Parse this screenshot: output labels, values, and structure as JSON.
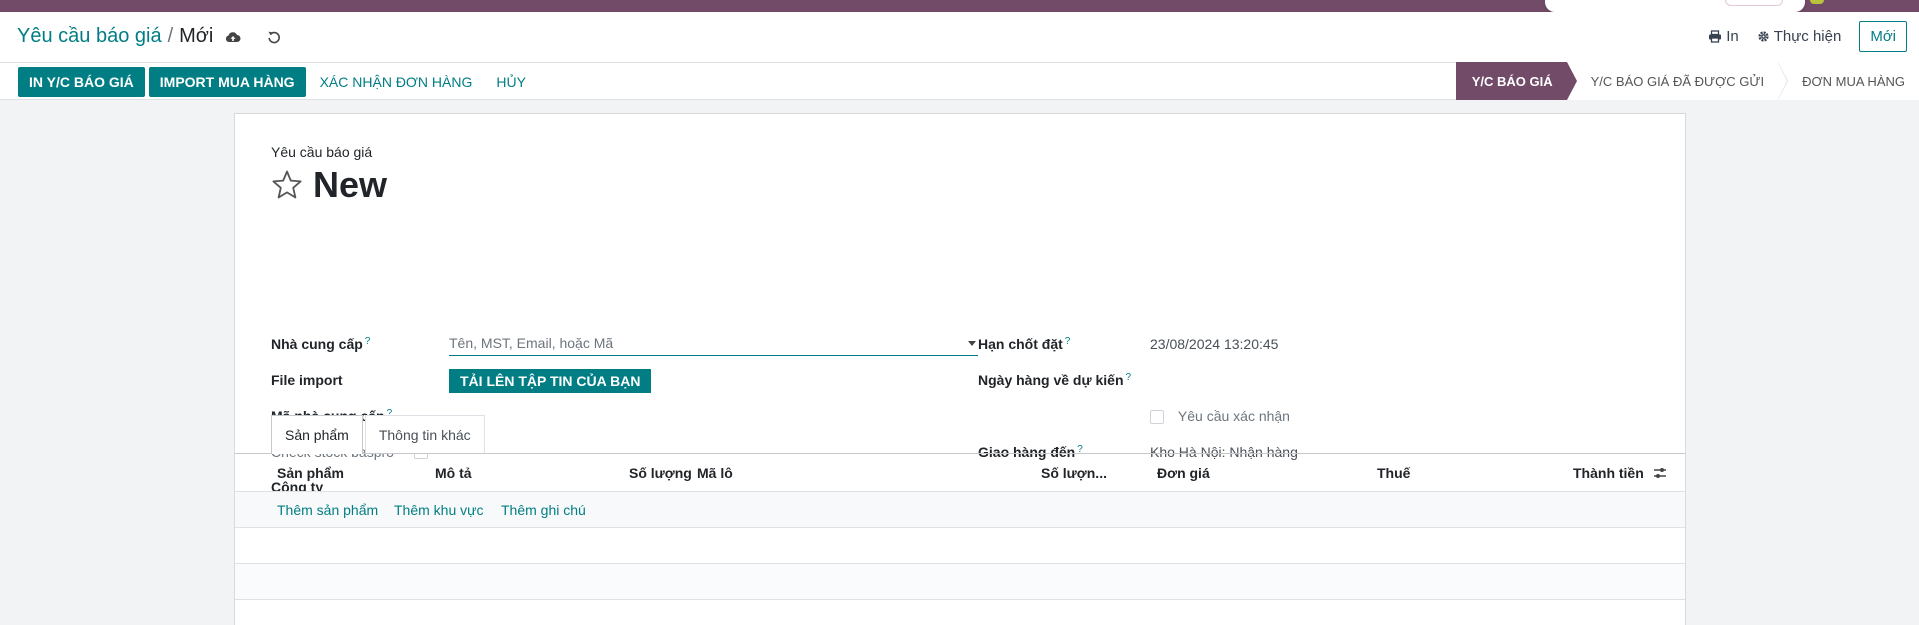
{
  "breadcrumb": {
    "parent": "Yêu cầu báo giá",
    "current": "Mới"
  },
  "control_panel": {
    "save_icon": "cloud-upload-icon",
    "discard_icon": "undo-icon",
    "print_label": "In",
    "action_label": "Thực hiện",
    "new_label": "Mới"
  },
  "statusbar": {
    "buttons": [
      {
        "label": "IN Y/C BÁO GIÁ",
        "style": "primary"
      },
      {
        "label": "IMPORT MUA HÀNG",
        "style": "primary"
      },
      {
        "label": "XÁC NHẬN ĐƠN HÀNG",
        "style": "link"
      },
      {
        "label": "HỦY",
        "style": "link"
      }
    ],
    "stages": [
      {
        "label": "Y/C BÁO GIÁ",
        "active": true
      },
      {
        "label": "Y/C BÁO GIÁ ĐÃ ĐƯỢC GỬI",
        "active": false
      },
      {
        "label": "ĐƠN MUA HÀNG",
        "active": false
      }
    ]
  },
  "form": {
    "subtitle": "Yêu cầu báo giá",
    "name": "New",
    "vendor": {
      "label": "Nhà cung cấp",
      "placeholder": "Tên, MST, Email, hoặc Mã"
    },
    "file_import": {
      "label": "File import",
      "button": "TẢI LÊN TẬP TIN CỦA BẠN"
    },
    "vendor_ref": {
      "label": "Mã nhà cung cấp"
    },
    "check_stock": {
      "label": "Check stock baspro"
    },
    "company": {
      "label": "Công ty"
    },
    "deadline": {
      "label": "Hạn chốt đặt",
      "value": "23/08/2024 13:20:45"
    },
    "expected_arrival": {
      "label": "Ngày hàng về dự kiến"
    },
    "ask_confirm": {
      "label": "Yêu cầu xác nhận"
    },
    "deliver_to": {
      "label": "Giao hàng đến",
      "value": "Kho Hà Nội: Nhận hàng"
    }
  },
  "tabs": [
    {
      "label": "Sản phẩm",
      "active": true
    },
    {
      "label": "Thông tin khác",
      "active": false
    }
  ],
  "table": {
    "headers": {
      "product": "Sản phẩm",
      "description": "Mô tả",
      "quantity": "Số lượng",
      "lot": "Mã lô",
      "quantity2": "Số lượn...",
      "unit_price": "Đơn giá",
      "tax": "Thuế",
      "subtotal": "Thành tiền"
    },
    "add_links": {
      "product": "Thêm sản phẩm",
      "section": "Thêm khu vực",
      "note": "Thêm ghi chú"
    }
  },
  "colors": {
    "primary": "#017e84",
    "brand": "#714b67"
  }
}
